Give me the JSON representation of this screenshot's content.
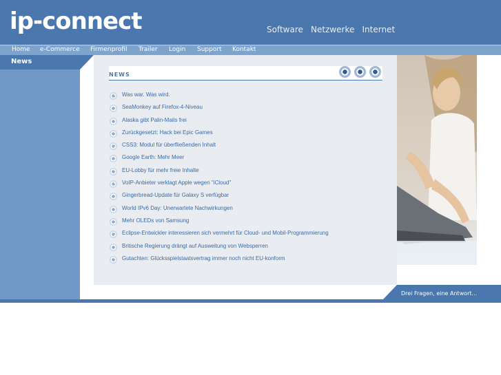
{
  "brand": {
    "logo_text": "ip-connect",
    "tagline": [
      "Software",
      "Netzwerke",
      "Internet"
    ]
  },
  "nav": {
    "items": [
      "Home",
      "e-Commerce",
      "Firmenprofil",
      "Trailer",
      "Login",
      "Support",
      "Kontakt"
    ]
  },
  "sidebar": {
    "active_label": "News"
  },
  "news": {
    "title": "NEWS",
    "items": [
      "Was war. Was wird.",
      "SeaMonkey auf Firefox-4-Niveau",
      "Alaska gibt Palin-Mails frei",
      "Zurückgesetzt: Hack bei Epic Games",
      "CSS3: Modul für überfließenden Inhalt",
      "Google Earth: Mehr Meer",
      "EU-Lobby für mehr freie Inhalte",
      "VoIP-Anbieter verklagt Apple wegen \"iCloud\"",
      "Gingerbread-Update für Galaxy S verfügbar",
      "World IPv6 Day: Unerwartete Nachwirkungen",
      "Mehr OLEDs von Samsung",
      "Eclipse-Entwickler interessieren sich vermehrt für Cloud- und Mobil-Programmierung",
      "Britische Regierung drängt auf Ausweitung von Websperren",
      "Gutachten: Glücksspielstaatsvertrag immer noch nicht EU-konform"
    ]
  },
  "footer": {
    "tab_label": "Drei Fragen, eine Antwort..."
  },
  "colors": {
    "header_blue": "#4a77ae",
    "nav_blue": "#7ea3cc",
    "sidebar_blue": "#7199c8",
    "panel_gray": "#e9edf2",
    "link_blue": "#3a6aa6"
  },
  "icons": {
    "nav_circles": [
      "circle-nav-icon",
      "circle-nav-icon",
      "circle-nav-icon"
    ],
    "news_bullet": "circle-bullet-icon"
  }
}
